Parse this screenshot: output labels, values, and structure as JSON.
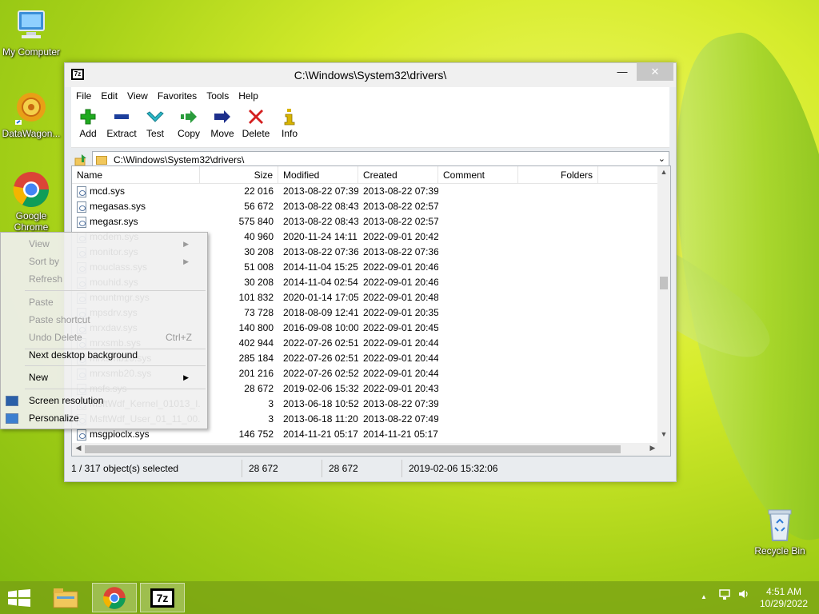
{
  "desktop": {
    "icons": [
      {
        "label": "My Computer"
      },
      {
        "label": "DataWagon..."
      },
      {
        "label": "Google Chrome"
      },
      {
        "label": "Recycle Bin"
      }
    ]
  },
  "window": {
    "title": "C:\\Windows\\System32\\drivers\\",
    "app_icon_text": "7z",
    "controls": {
      "minimize": "—",
      "maximize": "☐",
      "close": "✕"
    },
    "menu": [
      "File",
      "Edit",
      "View",
      "Favorites",
      "Tools",
      "Help"
    ],
    "toolbar": [
      {
        "label": "Add",
        "icon": "plus-icon",
        "color": "#1faa1f"
      },
      {
        "label": "Extract",
        "icon": "minus-icon",
        "color": "#1d3f9c"
      },
      {
        "label": "Test",
        "icon": "check-icon",
        "color": "#2ab8c8"
      },
      {
        "label": "Copy",
        "icon": "copy-arrow-icon",
        "color": "#2a9c3c"
      },
      {
        "label": "Move",
        "icon": "move-arrow-icon",
        "color": "#1d2f8c"
      },
      {
        "label": "Delete",
        "icon": "delete-x-icon",
        "color": "#d41f1f"
      },
      {
        "label": "Info",
        "icon": "info-icon",
        "color": "#d8b400"
      }
    ],
    "address": "C:\\Windows\\System32\\drivers\\",
    "columns": [
      "Name",
      "Size",
      "Modified",
      "Created",
      "Comment",
      "Folders"
    ],
    "files": [
      {
        "name": "mcd.sys",
        "size": "22 016",
        "modified": "2013-08-22 07:39",
        "created": "2013-08-22 07:39"
      },
      {
        "name": "megasas.sys",
        "size": "56 672",
        "modified": "2013-08-22 08:43",
        "created": "2013-08-22 02:57"
      },
      {
        "name": "megasr.sys",
        "size": "575 840",
        "modified": "2013-08-22 08:43",
        "created": "2013-08-22 02:57"
      },
      {
        "name": "modem.sys",
        "size": "40 960",
        "modified": "2020-11-24 14:11",
        "created": "2022-09-01 20:42"
      },
      {
        "name": "monitor.sys",
        "size": "30 208",
        "modified": "2013-08-22 07:36",
        "created": "2013-08-22 07:36"
      },
      {
        "name": "mouclass.sys",
        "size": "51 008",
        "modified": "2014-11-04 15:25",
        "created": "2022-09-01 20:46"
      },
      {
        "name": "mouhid.sys",
        "size": "30 208",
        "modified": "2014-11-04 02:54",
        "created": "2022-09-01 20:46"
      },
      {
        "name": "mountmgr.sys",
        "size": "101 832",
        "modified": "2020-01-14 17:05",
        "created": "2022-09-01 20:48"
      },
      {
        "name": "mpsdrv.sys",
        "size": "73 728",
        "modified": "2018-08-09 12:41",
        "created": "2022-09-01 20:35"
      },
      {
        "name": "mrxdav.sys",
        "size": "140 800",
        "modified": "2016-09-08 10:00",
        "created": "2022-09-01 20:45"
      },
      {
        "name": "mrxsmb.sys",
        "size": "402 944",
        "modified": "2022-07-26 02:51",
        "created": "2022-09-01 20:44"
      },
      {
        "name": "mrxsmb10.sys",
        "size": "285 184",
        "modified": "2022-07-26 02:51",
        "created": "2022-09-01 20:44"
      },
      {
        "name": "mrxsmb20.sys",
        "size": "201 216",
        "modified": "2022-07-26 02:52",
        "created": "2022-09-01 20:44"
      },
      {
        "name": "msfs.sys",
        "size": "28 672",
        "modified": "2019-02-06 15:32",
        "created": "2022-09-01 20:43"
      },
      {
        "name": "MsftWdf_Kernel_01013_I...",
        "size": "3",
        "modified": "2013-06-18 10:52",
        "created": "2013-08-22 07:39"
      },
      {
        "name": "MsftWdf_User_01_11_00...",
        "size": "3",
        "modified": "2013-06-18 11:20",
        "created": "2013-08-22 07:49"
      },
      {
        "name": "msgpioclx.sys",
        "size": "146 752",
        "modified": "2014-11-21 05:17",
        "created": "2014-11-21 05:17"
      }
    ],
    "status": {
      "selection": "1 / 317 object(s) selected",
      "size": "28 672",
      "packed": "28 672",
      "date": "2019-02-06 15:32:06"
    }
  },
  "context_menu": {
    "items": [
      {
        "label": "View",
        "disabled": true,
        "submenu": true
      },
      {
        "label": "Sort by",
        "disabled": true,
        "submenu": true
      },
      {
        "label": "Refresh",
        "disabled": true
      },
      {
        "label": "Paste",
        "disabled": true
      },
      {
        "label": "Paste shortcut",
        "disabled": true
      },
      {
        "label": "Undo Delete",
        "shortcut": "Ctrl+Z",
        "disabled": true
      },
      {
        "label": "Next desktop background"
      },
      {
        "label": "New",
        "submenu": true
      },
      {
        "label": "Screen resolution",
        "icon": "screen-resolution-icon"
      },
      {
        "label": "Personalize",
        "icon": "personalize-icon"
      }
    ],
    "submenu_arrow": "▶"
  },
  "taskbar": {
    "clock_time": "4:51 AM",
    "clock_date": "10/29/2022",
    "tray_arrow": "▲"
  },
  "colors": {
    "accent_green": "#7fb80e",
    "close_button": "#c7c7c7"
  }
}
